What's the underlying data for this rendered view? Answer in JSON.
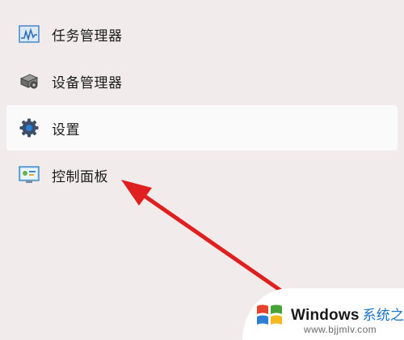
{
  "menu": {
    "items": [
      {
        "label": "任务管理器",
        "icon": "task-manager-icon"
      },
      {
        "label": "设备管理器",
        "icon": "device-manager-icon"
      },
      {
        "label": "设置",
        "icon": "gear-icon",
        "selected": true
      },
      {
        "label": "控制面板",
        "icon": "control-panel-icon"
      }
    ]
  },
  "annotation": {
    "arrow_color": "#e02020"
  },
  "watermark": {
    "brand": "Windows",
    "brand_cn": "系统之家",
    "url": "www.bjjmlv.com"
  },
  "colors": {
    "background": "#f1eceb",
    "selected_bg": "#fbfafa",
    "accent_blue": "#1a73c8"
  }
}
